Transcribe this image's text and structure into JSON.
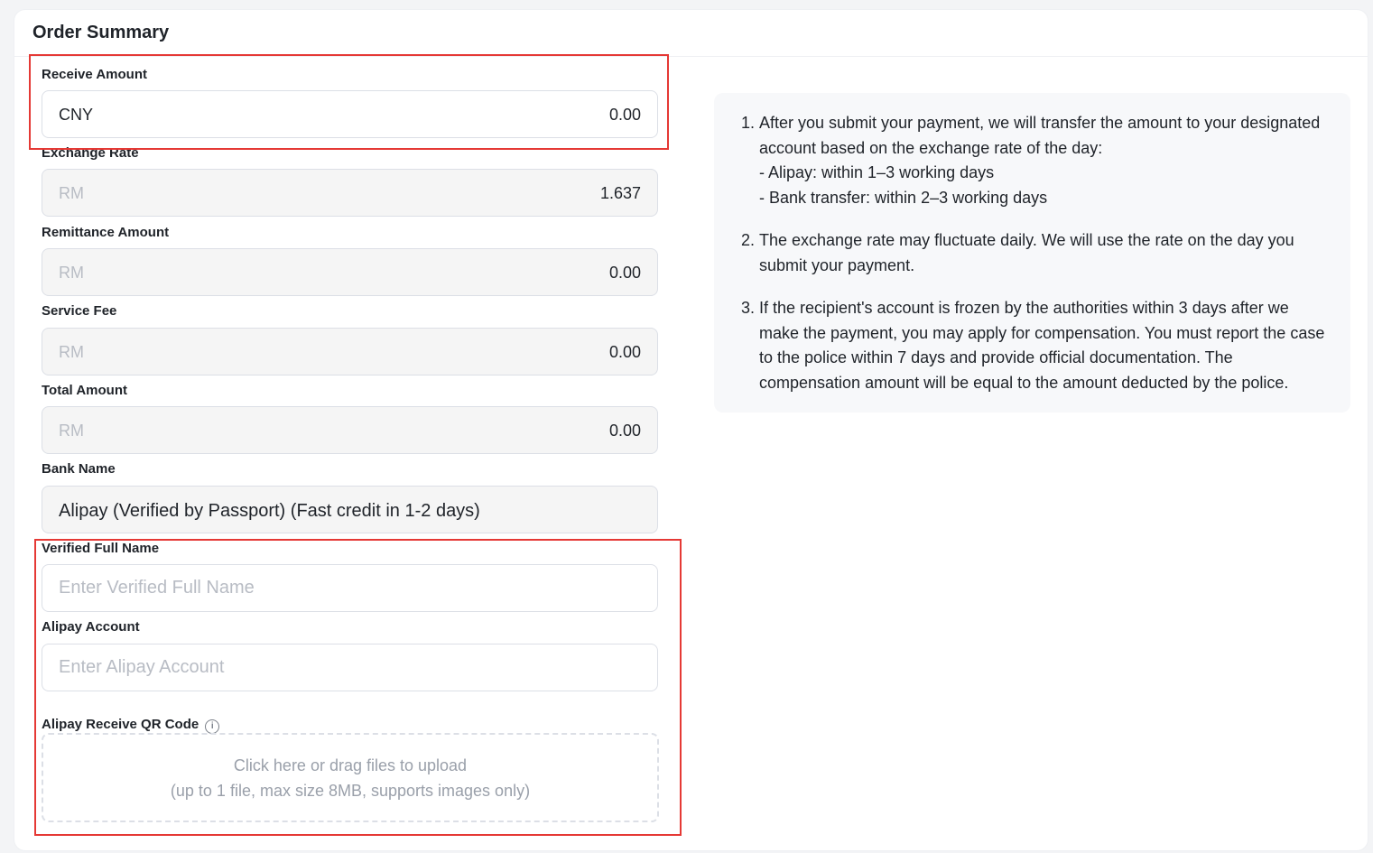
{
  "header": {
    "title": "Order Summary"
  },
  "form": {
    "receive_amount": {
      "label": "Receive Amount",
      "currency": "CNY",
      "value": "0.00"
    },
    "exchange_rate": {
      "label": "Exchange Rate",
      "currency": "RM",
      "value": "1.637"
    },
    "remittance_amount": {
      "label": "Remittance Amount",
      "currency": "RM",
      "value": "0.00"
    },
    "service_fee": {
      "label": "Service Fee",
      "currency": "RM",
      "value": "0.00"
    },
    "total_amount": {
      "label": "Total Amount",
      "currency": "RM",
      "value": "0.00"
    },
    "bank_name": {
      "label": "Bank Name",
      "value": "Alipay (Verified by Passport) (Fast credit in 1-2 days)"
    },
    "full_name": {
      "label": "Verified Full Name",
      "placeholder": "Enter Verified Full Name",
      "value": ""
    },
    "alipay_account": {
      "label": "Alipay Account",
      "placeholder": "Enter Alipay Account",
      "value": ""
    },
    "qr_code": {
      "label": "Alipay Receive QR Code",
      "info_icon": "info-icon",
      "upload_line1": "Click here or drag files to upload",
      "upload_line2": "(up to 1 file, max size 8MB, supports images only)"
    }
  },
  "notes": {
    "item1": {
      "text": "After you submit your payment, we will transfer the amount to your designated account based on the exchange rate of the day:",
      "sub1": "- Alipay: within 1–3 working days",
      "sub2": "- Bank transfer: within 2–3 working days"
    },
    "item2": "The exchange rate may fluctuate daily. We will use the rate on the day you submit your payment.",
    "item3": "If the recipient's account is frozen by the authorities within 3 days after we make the payment, you may apply for compensation. You must report the case to the police within 7 days and provide official documentation. The compensation amount will be equal to the amount deducted by the police."
  },
  "colors": {
    "highlight": "#e53935",
    "card_bg": "#ffffff",
    "readonly_bg": "#f5f5f5",
    "notes_bg": "#f7f8fa"
  }
}
